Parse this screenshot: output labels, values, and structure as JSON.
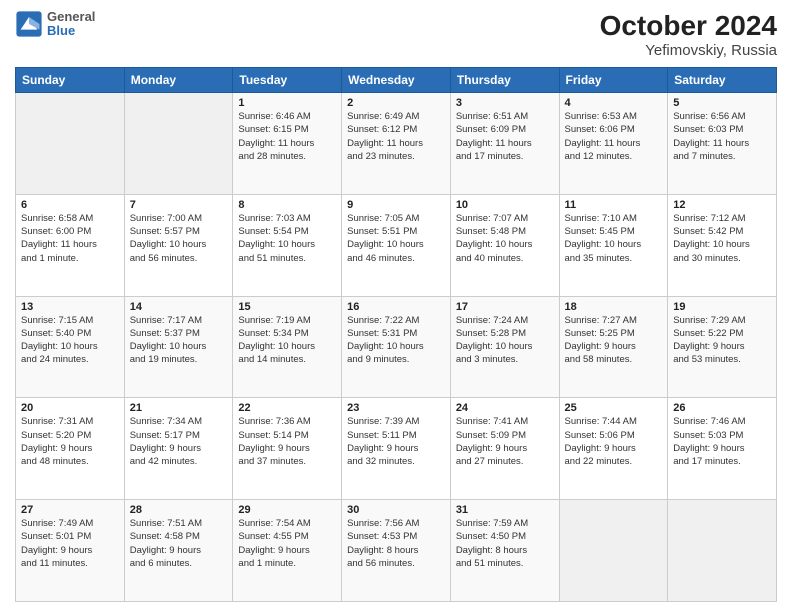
{
  "logo": {
    "line1": "General",
    "line2": "Blue"
  },
  "title": "October 2024",
  "subtitle": "Yefimovskiy, Russia",
  "weekdays": [
    "Sunday",
    "Monday",
    "Tuesday",
    "Wednesday",
    "Thursday",
    "Friday",
    "Saturday"
  ],
  "weeks": [
    [
      {
        "day": "",
        "info": ""
      },
      {
        "day": "",
        "info": ""
      },
      {
        "day": "1",
        "info": "Sunrise: 6:46 AM\nSunset: 6:15 PM\nDaylight: 11 hours\nand 28 minutes."
      },
      {
        "day": "2",
        "info": "Sunrise: 6:49 AM\nSunset: 6:12 PM\nDaylight: 11 hours\nand 23 minutes."
      },
      {
        "day": "3",
        "info": "Sunrise: 6:51 AM\nSunset: 6:09 PM\nDaylight: 11 hours\nand 17 minutes."
      },
      {
        "day": "4",
        "info": "Sunrise: 6:53 AM\nSunset: 6:06 PM\nDaylight: 11 hours\nand 12 minutes."
      },
      {
        "day": "5",
        "info": "Sunrise: 6:56 AM\nSunset: 6:03 PM\nDaylight: 11 hours\nand 7 minutes."
      }
    ],
    [
      {
        "day": "6",
        "info": "Sunrise: 6:58 AM\nSunset: 6:00 PM\nDaylight: 11 hours\nand 1 minute."
      },
      {
        "day": "7",
        "info": "Sunrise: 7:00 AM\nSunset: 5:57 PM\nDaylight: 10 hours\nand 56 minutes."
      },
      {
        "day": "8",
        "info": "Sunrise: 7:03 AM\nSunset: 5:54 PM\nDaylight: 10 hours\nand 51 minutes."
      },
      {
        "day": "9",
        "info": "Sunrise: 7:05 AM\nSunset: 5:51 PM\nDaylight: 10 hours\nand 46 minutes."
      },
      {
        "day": "10",
        "info": "Sunrise: 7:07 AM\nSunset: 5:48 PM\nDaylight: 10 hours\nand 40 minutes."
      },
      {
        "day": "11",
        "info": "Sunrise: 7:10 AM\nSunset: 5:45 PM\nDaylight: 10 hours\nand 35 minutes."
      },
      {
        "day": "12",
        "info": "Sunrise: 7:12 AM\nSunset: 5:42 PM\nDaylight: 10 hours\nand 30 minutes."
      }
    ],
    [
      {
        "day": "13",
        "info": "Sunrise: 7:15 AM\nSunset: 5:40 PM\nDaylight: 10 hours\nand 24 minutes."
      },
      {
        "day": "14",
        "info": "Sunrise: 7:17 AM\nSunset: 5:37 PM\nDaylight: 10 hours\nand 19 minutes."
      },
      {
        "day": "15",
        "info": "Sunrise: 7:19 AM\nSunset: 5:34 PM\nDaylight: 10 hours\nand 14 minutes."
      },
      {
        "day": "16",
        "info": "Sunrise: 7:22 AM\nSunset: 5:31 PM\nDaylight: 10 hours\nand 9 minutes."
      },
      {
        "day": "17",
        "info": "Sunrise: 7:24 AM\nSunset: 5:28 PM\nDaylight: 10 hours\nand 3 minutes."
      },
      {
        "day": "18",
        "info": "Sunrise: 7:27 AM\nSunset: 5:25 PM\nDaylight: 9 hours\nand 58 minutes."
      },
      {
        "day": "19",
        "info": "Sunrise: 7:29 AM\nSunset: 5:22 PM\nDaylight: 9 hours\nand 53 minutes."
      }
    ],
    [
      {
        "day": "20",
        "info": "Sunrise: 7:31 AM\nSunset: 5:20 PM\nDaylight: 9 hours\nand 48 minutes."
      },
      {
        "day": "21",
        "info": "Sunrise: 7:34 AM\nSunset: 5:17 PM\nDaylight: 9 hours\nand 42 minutes."
      },
      {
        "day": "22",
        "info": "Sunrise: 7:36 AM\nSunset: 5:14 PM\nDaylight: 9 hours\nand 37 minutes."
      },
      {
        "day": "23",
        "info": "Sunrise: 7:39 AM\nSunset: 5:11 PM\nDaylight: 9 hours\nand 32 minutes."
      },
      {
        "day": "24",
        "info": "Sunrise: 7:41 AM\nSunset: 5:09 PM\nDaylight: 9 hours\nand 27 minutes."
      },
      {
        "day": "25",
        "info": "Sunrise: 7:44 AM\nSunset: 5:06 PM\nDaylight: 9 hours\nand 22 minutes."
      },
      {
        "day": "26",
        "info": "Sunrise: 7:46 AM\nSunset: 5:03 PM\nDaylight: 9 hours\nand 17 minutes."
      }
    ],
    [
      {
        "day": "27",
        "info": "Sunrise: 7:49 AM\nSunset: 5:01 PM\nDaylight: 9 hours\nand 11 minutes."
      },
      {
        "day": "28",
        "info": "Sunrise: 7:51 AM\nSunset: 4:58 PM\nDaylight: 9 hours\nand 6 minutes."
      },
      {
        "day": "29",
        "info": "Sunrise: 7:54 AM\nSunset: 4:55 PM\nDaylight: 9 hours\nand 1 minute."
      },
      {
        "day": "30",
        "info": "Sunrise: 7:56 AM\nSunset: 4:53 PM\nDaylight: 8 hours\nand 56 minutes."
      },
      {
        "day": "31",
        "info": "Sunrise: 7:59 AM\nSunset: 4:50 PM\nDaylight: 8 hours\nand 51 minutes."
      },
      {
        "day": "",
        "info": ""
      },
      {
        "day": "",
        "info": ""
      }
    ]
  ]
}
